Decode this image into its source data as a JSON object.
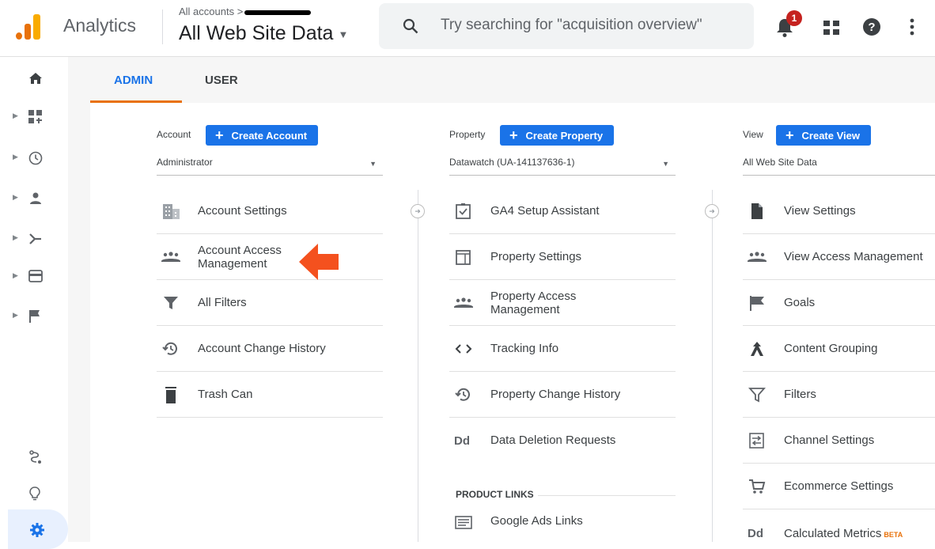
{
  "header": {
    "app_name": "Analytics",
    "breadcrumb": "All accounts >",
    "view_selector": "All Web Site Data",
    "search_placeholder": "Try searching for \"acquisition overview\"",
    "notification_count": "1"
  },
  "tabs": [
    {
      "label": "ADMIN",
      "active": true
    },
    {
      "label": "USER",
      "active": false
    }
  ],
  "colors": {
    "accent": "#1a73e8",
    "tab_underline": "#e8710a",
    "callout_arrow": "#f4511e",
    "badge": "#c5221f"
  },
  "account": {
    "label": "Account",
    "create_label": "Create Account",
    "selected": "Administrator",
    "items": [
      {
        "label": "Account Settings",
        "icon": "building-icon"
      },
      {
        "label": "Account Access Management",
        "icon": "people-icon"
      },
      {
        "label": "All Filters",
        "icon": "filter-icon"
      },
      {
        "label": "Account Change History",
        "icon": "history-icon"
      },
      {
        "label": "Trash Can",
        "icon": "trash-icon"
      }
    ]
  },
  "property": {
    "label": "Property",
    "create_label": "Create Property",
    "selected": "Datawatch (UA-141137636-1)",
    "items": [
      {
        "label": "GA4 Setup Assistant",
        "icon": "checkbox-icon"
      },
      {
        "label": "Property Settings",
        "icon": "layout-icon"
      },
      {
        "label": "Property Access Management",
        "icon": "people-icon"
      },
      {
        "label": "Tracking Info",
        "icon": "code-icon"
      },
      {
        "label": "Property Change History",
        "icon": "history-icon"
      },
      {
        "label": "Data Deletion Requests",
        "icon": "dd-icon",
        "icon_text": "Dd"
      }
    ],
    "section_heading": "PRODUCT LINKS",
    "links": [
      {
        "label": "Google Ads Links",
        "icon": "ads-icon"
      }
    ]
  },
  "view": {
    "label": "View",
    "create_label": "Create View",
    "selected": "All Web Site Data",
    "items": [
      {
        "label": "View Settings",
        "icon": "document-icon"
      },
      {
        "label": "View Access Management",
        "icon": "people-icon"
      },
      {
        "label": "Goals",
        "icon": "flag-icon"
      },
      {
        "label": "Content Grouping",
        "icon": "grouping-icon"
      },
      {
        "label": "Filters",
        "icon": "filter-icon"
      },
      {
        "label": "Channel Settings",
        "icon": "channel-icon"
      },
      {
        "label": "Ecommerce Settings",
        "icon": "cart-icon"
      },
      {
        "label": "Calculated Metrics",
        "icon": "dd-icon",
        "icon_text": "Dd",
        "badge": "BETA"
      }
    ]
  }
}
